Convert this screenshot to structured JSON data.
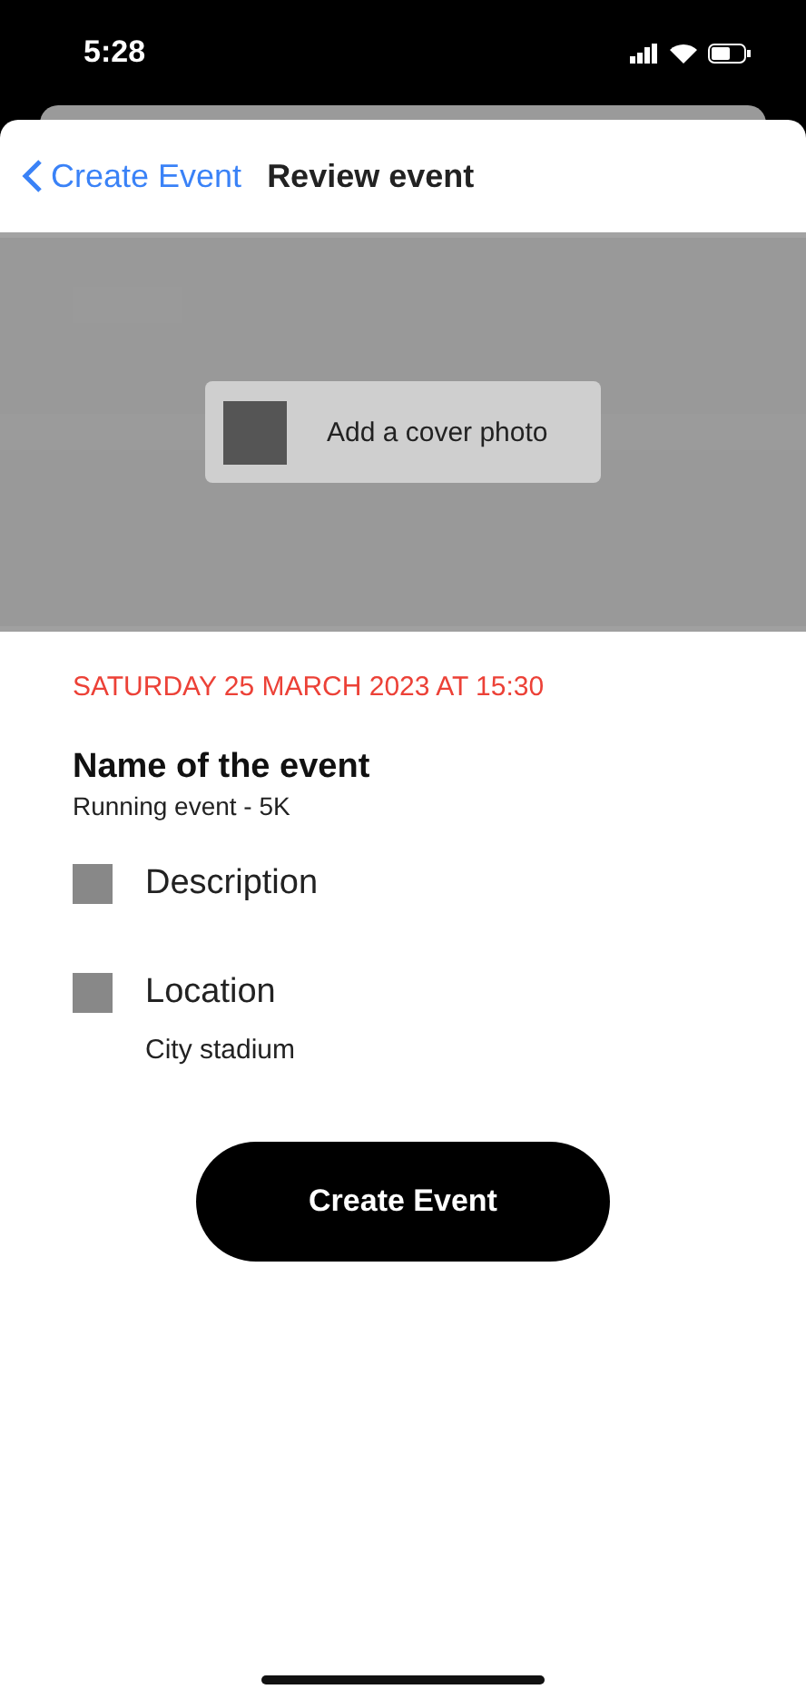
{
  "status_bar": {
    "time": "5:28"
  },
  "nav": {
    "back_label": "Create Event",
    "title": "Review event"
  },
  "cover": {
    "kind": "picture",
    "action": "Add a cover photo"
  },
  "event": {
    "date": "SATURDAY 25 MARCH 2023 AT 15:30",
    "name_label": "Name of the event",
    "name": "Running event - 5K"
  },
  "details": [
    {
      "label": "Description"
    },
    {
      "label": "Location",
      "value": "City stadium"
    }
  ],
  "primary_button": "Create Event"
}
